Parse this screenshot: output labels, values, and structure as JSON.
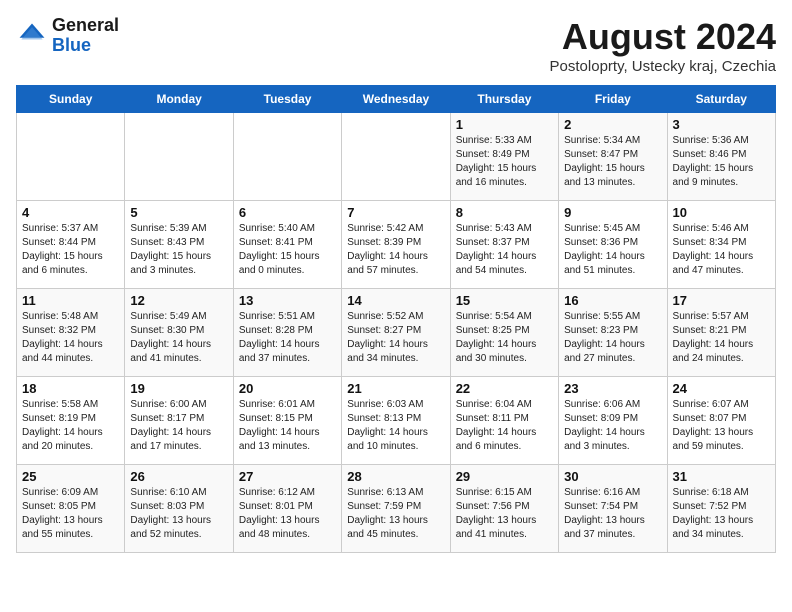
{
  "header": {
    "logo_general": "General",
    "logo_blue": "Blue",
    "month_title": "August 2024",
    "subtitle": "Postoloprty, Ustecky kraj, Czechia"
  },
  "days_of_week": [
    "Sunday",
    "Monday",
    "Tuesday",
    "Wednesday",
    "Thursday",
    "Friday",
    "Saturday"
  ],
  "weeks": [
    [
      {
        "day": "",
        "info": ""
      },
      {
        "day": "",
        "info": ""
      },
      {
        "day": "",
        "info": ""
      },
      {
        "day": "",
        "info": ""
      },
      {
        "day": "1",
        "info": "Sunrise: 5:33 AM\nSunset: 8:49 PM\nDaylight: 15 hours\nand 16 minutes."
      },
      {
        "day": "2",
        "info": "Sunrise: 5:34 AM\nSunset: 8:47 PM\nDaylight: 15 hours\nand 13 minutes."
      },
      {
        "day": "3",
        "info": "Sunrise: 5:36 AM\nSunset: 8:46 PM\nDaylight: 15 hours\nand 9 minutes."
      }
    ],
    [
      {
        "day": "4",
        "info": "Sunrise: 5:37 AM\nSunset: 8:44 PM\nDaylight: 15 hours\nand 6 minutes."
      },
      {
        "day": "5",
        "info": "Sunrise: 5:39 AM\nSunset: 8:43 PM\nDaylight: 15 hours\nand 3 minutes."
      },
      {
        "day": "6",
        "info": "Sunrise: 5:40 AM\nSunset: 8:41 PM\nDaylight: 15 hours\nand 0 minutes."
      },
      {
        "day": "7",
        "info": "Sunrise: 5:42 AM\nSunset: 8:39 PM\nDaylight: 14 hours\nand 57 minutes."
      },
      {
        "day": "8",
        "info": "Sunrise: 5:43 AM\nSunset: 8:37 PM\nDaylight: 14 hours\nand 54 minutes."
      },
      {
        "day": "9",
        "info": "Sunrise: 5:45 AM\nSunset: 8:36 PM\nDaylight: 14 hours\nand 51 minutes."
      },
      {
        "day": "10",
        "info": "Sunrise: 5:46 AM\nSunset: 8:34 PM\nDaylight: 14 hours\nand 47 minutes."
      }
    ],
    [
      {
        "day": "11",
        "info": "Sunrise: 5:48 AM\nSunset: 8:32 PM\nDaylight: 14 hours\nand 44 minutes."
      },
      {
        "day": "12",
        "info": "Sunrise: 5:49 AM\nSunset: 8:30 PM\nDaylight: 14 hours\nand 41 minutes."
      },
      {
        "day": "13",
        "info": "Sunrise: 5:51 AM\nSunset: 8:28 PM\nDaylight: 14 hours\nand 37 minutes."
      },
      {
        "day": "14",
        "info": "Sunrise: 5:52 AM\nSunset: 8:27 PM\nDaylight: 14 hours\nand 34 minutes."
      },
      {
        "day": "15",
        "info": "Sunrise: 5:54 AM\nSunset: 8:25 PM\nDaylight: 14 hours\nand 30 minutes."
      },
      {
        "day": "16",
        "info": "Sunrise: 5:55 AM\nSunset: 8:23 PM\nDaylight: 14 hours\nand 27 minutes."
      },
      {
        "day": "17",
        "info": "Sunrise: 5:57 AM\nSunset: 8:21 PM\nDaylight: 14 hours\nand 24 minutes."
      }
    ],
    [
      {
        "day": "18",
        "info": "Sunrise: 5:58 AM\nSunset: 8:19 PM\nDaylight: 14 hours\nand 20 minutes."
      },
      {
        "day": "19",
        "info": "Sunrise: 6:00 AM\nSunset: 8:17 PM\nDaylight: 14 hours\nand 17 minutes."
      },
      {
        "day": "20",
        "info": "Sunrise: 6:01 AM\nSunset: 8:15 PM\nDaylight: 14 hours\nand 13 minutes."
      },
      {
        "day": "21",
        "info": "Sunrise: 6:03 AM\nSunset: 8:13 PM\nDaylight: 14 hours\nand 10 minutes."
      },
      {
        "day": "22",
        "info": "Sunrise: 6:04 AM\nSunset: 8:11 PM\nDaylight: 14 hours\nand 6 minutes."
      },
      {
        "day": "23",
        "info": "Sunrise: 6:06 AM\nSunset: 8:09 PM\nDaylight: 14 hours\nand 3 minutes."
      },
      {
        "day": "24",
        "info": "Sunrise: 6:07 AM\nSunset: 8:07 PM\nDaylight: 13 hours\nand 59 minutes."
      }
    ],
    [
      {
        "day": "25",
        "info": "Sunrise: 6:09 AM\nSunset: 8:05 PM\nDaylight: 13 hours\nand 55 minutes."
      },
      {
        "day": "26",
        "info": "Sunrise: 6:10 AM\nSunset: 8:03 PM\nDaylight: 13 hours\nand 52 minutes."
      },
      {
        "day": "27",
        "info": "Sunrise: 6:12 AM\nSunset: 8:01 PM\nDaylight: 13 hours\nand 48 minutes."
      },
      {
        "day": "28",
        "info": "Sunrise: 6:13 AM\nSunset: 7:59 PM\nDaylight: 13 hours\nand 45 minutes."
      },
      {
        "day": "29",
        "info": "Sunrise: 6:15 AM\nSunset: 7:56 PM\nDaylight: 13 hours\nand 41 minutes."
      },
      {
        "day": "30",
        "info": "Sunrise: 6:16 AM\nSunset: 7:54 PM\nDaylight: 13 hours\nand 37 minutes."
      },
      {
        "day": "31",
        "info": "Sunrise: 6:18 AM\nSunset: 7:52 PM\nDaylight: 13 hours\nand 34 minutes."
      }
    ]
  ]
}
